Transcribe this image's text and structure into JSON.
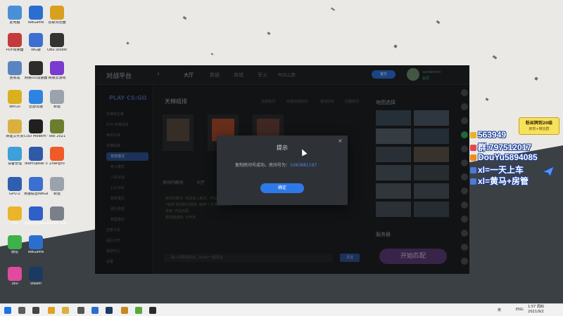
{
  "desktop": {
    "icons": [
      {
        "label": "此电脑",
        "color": "#4a8fd8"
      },
      {
        "label": "WeGame",
        "color": "#2a6fd0"
      },
      {
        "label": "谷歌浏览器",
        "color": "#d9a020"
      },
      {
        "label": "PDF阅读器",
        "color": "#c43b3b"
      },
      {
        "label": "WG速",
        "color": "#3d6fd0"
      },
      {
        "label": "OBS Studio",
        "color": "#333"
      },
      {
        "label": "回收站",
        "color": "#5b85c0"
      },
      {
        "label": "网易UU加速器",
        "color": "#2c2c2c"
      },
      {
        "label": "网易云游戏",
        "color": "#7a3bd1"
      },
      {
        "label": "Win10",
        "color": "#d9b020"
      },
      {
        "label": "迅游加速",
        "color": "#2d84e0"
      },
      {
        "label": "新建",
        "color": "#9aa3ab"
      },
      {
        "label": "新建文件夹",
        "color": "#d9b040"
      },
      {
        "label": "COD Modern Warfare",
        "color": "#202020"
      },
      {
        "label": "Tool 2021",
        "color": "#6a7e2e"
      },
      {
        "label": "设备管理",
        "color": "#3ea0d8"
      },
      {
        "label": "TeamSpeak 3",
        "color": "#2e5aa8"
      },
      {
        "label": "ZhangYu",
        "color": "#f05a28"
      },
      {
        "label": "GPU-Z",
        "color": "#2f5fb0"
      },
      {
        "label": "英雄联盟WeGame版",
        "color": "#3b6fd0"
      },
      {
        "label": "新建",
        "color": "#9aa3ab"
      },
      {
        "label": "QQ",
        "color": "#eab42b"
      },
      {
        "label": "英雄联盟WeGame版",
        "color": "#2f5fc8"
      },
      {
        "label": "Steam 设置",
        "color": "#7a8089"
      },
      {
        "label": "微信",
        "color": "#3fb14a"
      },
      {
        "label": "WeGame",
        "color": "#2a6fd0"
      },
      {
        "label": "360",
        "color": "#e04aa0"
      },
      {
        "label": "Steam",
        "color": "#1b3a62"
      }
    ]
  },
  "app": {
    "logo": "对战平台",
    "nav": [
      "大厅",
      "数据",
      "商城",
      "军火",
      "ROLL房"
    ],
    "active_nav": 0,
    "status_pill": "官方",
    "user": {
      "name": "sandstorm",
      "level": "会员"
    },
    "sidebar": {
      "header": "PLAY CS:GO",
      "items": [
        "天梯排位赛",
        "5V5 天梯战场",
        "休闲对战",
        "天梯组排",
        "竞技模式",
        "死斗模式",
        "人机对战",
        "1v1对战",
        "跳跃模式",
        "团队竞技",
        "跑图模式",
        "创意工坊",
        "组队大厅",
        "帮助中心",
        "设置"
      ],
      "selected_index": 3
    },
    "section_title": "天梯组排",
    "toolbar": [
      "全部房间",
      "快速创建房间",
      "邀请好友",
      "创建房间"
    ],
    "chat_tabs": [
      "房间内聊天",
      "大厅"
    ],
    "chat_lines": [
      "房间内聊天: 欢迎进入房间，开始游戏吧!",
      "\"组排\"系列积分规则: AWP / 开局前请准备",
      "系统: 开始匹配",
      "服务器通知: 已开启"
    ],
    "chat_placeholder": "输入你要说的话，Enter一键发送",
    "send_label": "发送",
    "right_panel": {
      "map_title": "地图选择",
      "server_title": "服务器",
      "start_label": "开始匹配"
    }
  },
  "dialog": {
    "title": "提示",
    "message": "复制房间号成功，房间号为：",
    "room_number": "1083881197",
    "ok_label": "确定",
    "close_glyph": "×"
  },
  "stream_overlay": {
    "badge_line1": "粉丝牌到20级",
    "badge_line2": "房管+微信群",
    "lines": [
      {
        "text": "563949",
        "icon_color": "#e9b22a"
      },
      {
        "text": "群:797512017",
        "icon_color": "#e24848"
      },
      {
        "text": "DouYu5894085",
        "icon_color": "#f08a1c"
      },
      {
        "text": "xl=一天上车",
        "icon_color": "#4a7bd6"
      },
      {
        "text": "xl=黄马+房管",
        "icon_color": "#4a7bd6"
      }
    ]
  },
  "taskbar": {
    "tray_text": "ENG",
    "tray_ime": "英",
    "time": "1:57 周四",
    "date": "2021/9/2"
  }
}
